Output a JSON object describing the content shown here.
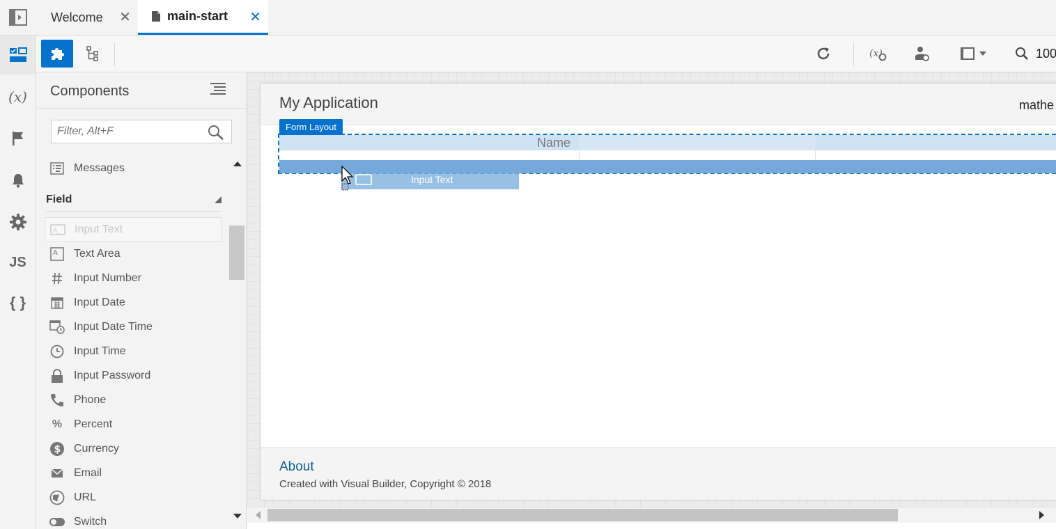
{
  "tabs": [
    {
      "label": "Welcome",
      "active": false
    },
    {
      "label": "main-start",
      "active": true
    }
  ],
  "tab_close_glyph": "✕",
  "rail": {
    "items": [
      {
        "icon": "page-designer-icon",
        "active": true
      },
      {
        "icon": "variables-icon",
        "text": "(x)"
      },
      {
        "icon": "flag-icon"
      },
      {
        "icon": "bell-icon"
      },
      {
        "icon": "gear-icon"
      },
      {
        "icon": "js-icon",
        "text": "JS"
      },
      {
        "icon": "json-icon",
        "text": "{ }"
      }
    ]
  },
  "toolbar": {
    "zoom_label": "100",
    "accent_color": "#0572ce"
  },
  "panel": {
    "title": "Components",
    "filter_placeholder": "Filter, Alt+F",
    "top_item": "Messages",
    "section": "Field",
    "items": [
      "Input Text",
      "Text Area",
      "Input Number",
      "Input Date",
      "Input Date Time",
      "Input Time",
      "Input Password",
      "Phone",
      "Percent",
      "Currency",
      "Email",
      "URL",
      "Switch"
    ]
  },
  "canvas": {
    "app_title": "My Application",
    "user": "mathe",
    "form_layout_tag": "Form Layout",
    "form_label": "Name",
    "drag_label": "Input Text",
    "footer_link": "About",
    "footer_text": "Created with Visual Builder, Copyright © 2018"
  }
}
